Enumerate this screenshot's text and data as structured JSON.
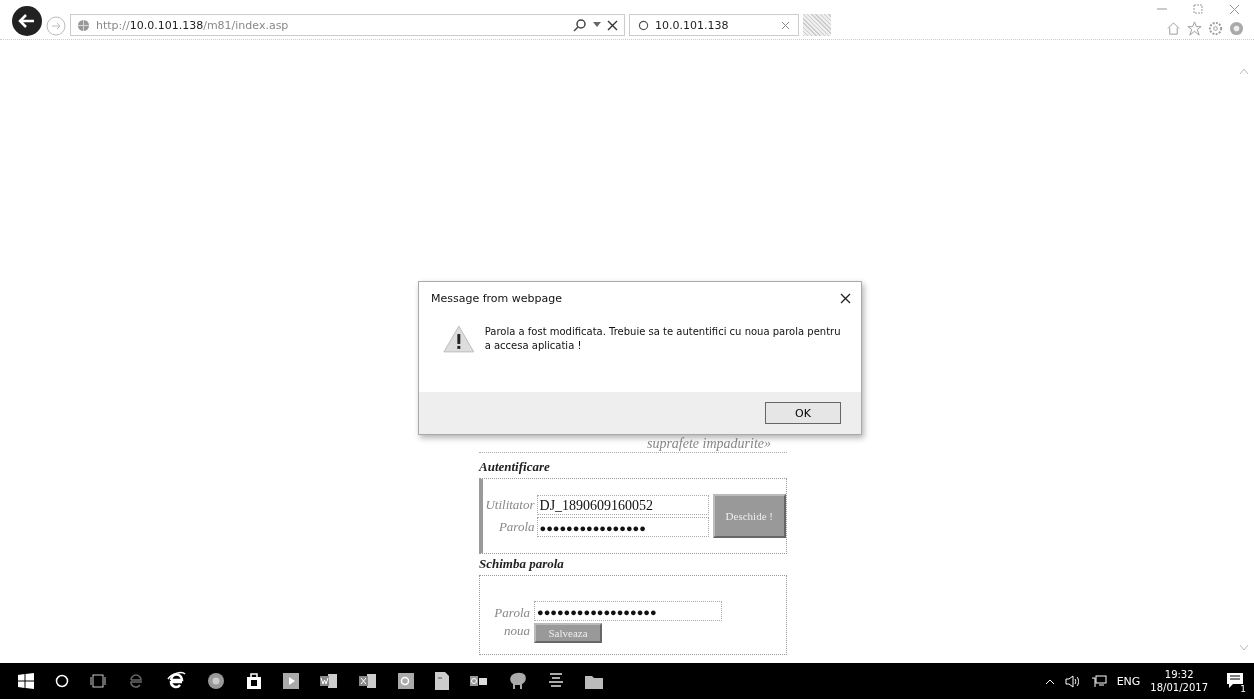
{
  "browser": {
    "address": "http://**10.0.101.138**/m81/index.asp",
    "tab": {
      "title": "10.0.101.138",
      "selected": true
    }
  },
  "page": {
    "tagline_fragment": "suprafete impadurite»",
    "login": {
      "title": "Autentificare",
      "user_label": "Utilitator",
      "user_value": "DJ_1890609160052",
      "password_label": "Parola",
      "password_value": "●●●●●●●●●●●●●●●●",
      "button": "Deschide !"
    },
    "change_password": {
      "title": "Schimba parola",
      "label_line_1": "Parola",
      "label_line_2": "noua",
      "value": "●●●●●●●●●●●●●●●●●●",
      "button": "Salveaza"
    }
  },
  "dialog": {
    "title": "Message from webpage",
    "message": "Parola a fost modificata. Trebuie sa te autentifici cu noua parola pentru a accesa aplicatia !",
    "button": "OK"
  },
  "taskbar": {
    "language": "ENG",
    "time": "19:32",
    "date": "18/01/2017",
    "notification_count": "1"
  }
}
